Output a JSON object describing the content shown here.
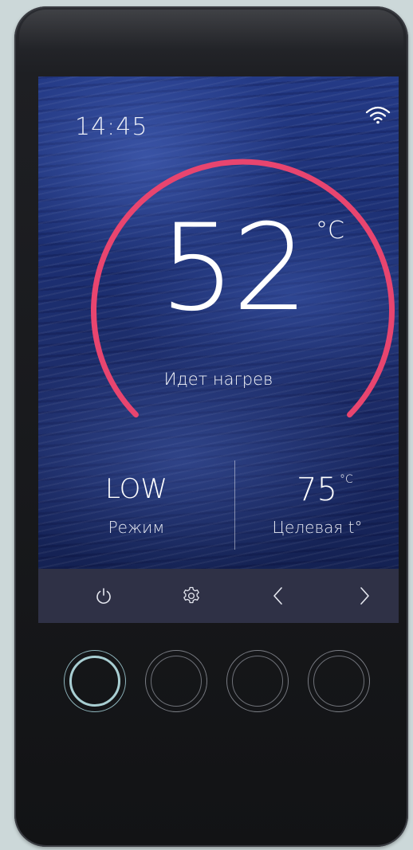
{
  "status_bar": {
    "time": "14:45",
    "wifi_icon": "wifi-icon"
  },
  "gauge": {
    "temperature": "52",
    "unit": "°C",
    "status": "Идет нагрев",
    "arc_color": "#e8456f"
  },
  "mode": {
    "value": "LOW",
    "label": "Режим"
  },
  "target": {
    "value": "75",
    "unit": "°C",
    "label": "Целевая t°"
  },
  "toolbar": {
    "buttons": [
      {
        "icon": "power-icon"
      },
      {
        "icon": "gear-icon"
      },
      {
        "icon": "chevron-left-icon"
      },
      {
        "icon": "chevron-right-icon"
      }
    ]
  },
  "hardware_buttons": [
    {
      "state": "active",
      "color": "#a9cfd3"
    },
    {
      "state": "idle"
    },
    {
      "state": "idle"
    },
    {
      "state": "idle"
    }
  ]
}
